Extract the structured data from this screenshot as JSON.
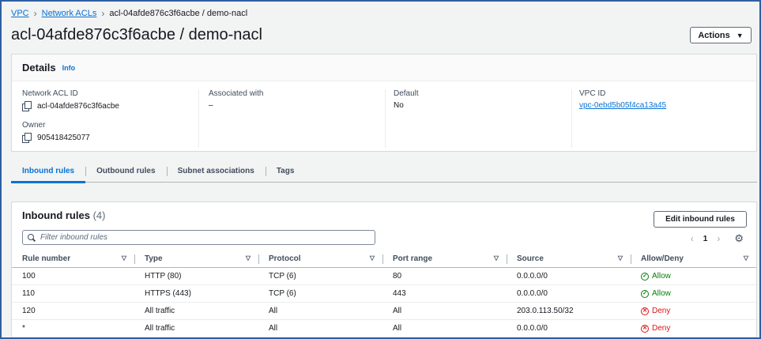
{
  "breadcrumb": {
    "vpc": "VPC",
    "network_acls": "Network ACLs",
    "current": "acl-04afde876c3f6acbe / demo-nacl"
  },
  "page_title": "acl-04afde876c3f6acbe / demo-nacl",
  "actions_label": "Actions",
  "details": {
    "heading": "Details",
    "info_label": "Info",
    "network_acl_id_label": "Network ACL ID",
    "network_acl_id": "acl-04afde876c3f6acbe",
    "owner_label": "Owner",
    "owner": "905418425077",
    "associated_with_label": "Associated with",
    "associated_with": "–",
    "default_label": "Default",
    "default": "No",
    "vpc_id_label": "VPC ID",
    "vpc_id": "vpc-0ebd5b05f4ca13a45"
  },
  "tabs": [
    {
      "label": "Inbound rules",
      "active": true
    },
    {
      "label": "Outbound rules",
      "active": false
    },
    {
      "label": "Subnet associations",
      "active": false
    },
    {
      "label": "Tags",
      "active": false
    }
  ],
  "inbound": {
    "title": "Inbound rules",
    "count": "(4)",
    "edit_label": "Edit inbound rules",
    "filter_placeholder": "Filter inbound rules",
    "page": "1",
    "columns": [
      "Rule number",
      "Type",
      "Protocol",
      "Port range",
      "Source",
      "Allow/Deny"
    ],
    "rows": [
      {
        "rule": "100",
        "type": "HTTP (80)",
        "protocol": "TCP (6)",
        "port": "80",
        "source": "0.0.0.0/0",
        "action": "Allow"
      },
      {
        "rule": "110",
        "type": "HTTPS (443)",
        "protocol": "TCP (6)",
        "port": "443",
        "source": "0.0.0.0/0",
        "action": "Allow"
      },
      {
        "rule": "120",
        "type": "All traffic",
        "protocol": "All",
        "port": "All",
        "source": "203.0.113.50/32",
        "action": "Deny"
      },
      {
        "rule": "*",
        "type": "All traffic",
        "protocol": "All",
        "port": "All",
        "source": "0.0.0.0/0",
        "action": "Deny"
      }
    ]
  },
  "colors": {
    "link": "#0972d3",
    "allow": "#037f0c",
    "deny": "#d91515",
    "frame": "#2e5fa3"
  }
}
